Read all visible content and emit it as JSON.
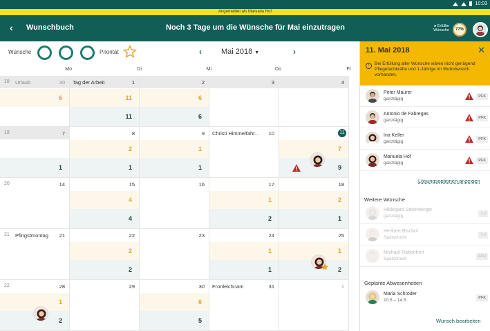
{
  "status": {
    "time": "10:03"
  },
  "login_banner": "Angemeldet als Manuela Hof",
  "appbar": {
    "title": "Wunschbuch",
    "headline": "Noch 3 Tage um die Wünsche für Mai einzutragen",
    "fulfilled_label": "ø Erfüllte Wünsche",
    "fulfilled_pct": "77%"
  },
  "toolbar": {
    "wishes_label": "Wünsche",
    "priority_label": "Priorität",
    "month": "Mai 2018",
    "prev_symbol": "‹",
    "next_symbol": "›"
  },
  "weekdays": [
    "Mo",
    "Di",
    "Mi",
    "Do",
    "Fr"
  ],
  "rows": [
    {
      "week": "18",
      "cells": [
        {
          "label": "Urlaub",
          "day": "30",
          "muted_day": true,
          "grey": true,
          "prio": "6",
          "wish": "",
          "label_muted": true
        },
        {
          "label": "Tag der Arbeit",
          "day": "1",
          "grey": true,
          "prio": "11",
          "wish": "11"
        },
        {
          "label": "",
          "day": "2",
          "grey": true,
          "prio": "6",
          "wish": "6"
        },
        {
          "label": "",
          "day": "3",
          "grey": true,
          "prio": "",
          "wish": ""
        },
        {
          "label": "",
          "day": "4",
          "grey": true,
          "prio": "",
          "wish": ""
        }
      ]
    },
    {
      "week": "19",
      "cells": [
        {
          "label": "",
          "day": "7",
          "grey": true,
          "prio": "",
          "wish": "1"
        },
        {
          "label": "",
          "day": "8",
          "prio": "2",
          "wish": "1"
        },
        {
          "label": "",
          "day": "9",
          "prio": "1",
          "wish": "1"
        },
        {
          "label": "Christi Himmelfahr...",
          "day": "10",
          "prio": "",
          "wish": ""
        },
        {
          "label": "",
          "day": "11",
          "today": true,
          "prio": "7",
          "wish": "9"
        }
      ]
    },
    {
      "week": "20",
      "cells": [
        {
          "label": "",
          "day": "14",
          "prio": "",
          "wish": ""
        },
        {
          "label": "",
          "day": "15",
          "prio": "4",
          "wish": "4"
        },
        {
          "label": "",
          "day": "16",
          "prio": "",
          "wish": ""
        },
        {
          "label": "",
          "day": "17",
          "prio": "1",
          "wish": "2"
        },
        {
          "label": "",
          "day": "18",
          "prio": "2",
          "wish": "1"
        }
      ]
    },
    {
      "week": "21",
      "cells": [
        {
          "label": "Pfingstmontag",
          "day": "21",
          "prio": "",
          "wish": ""
        },
        {
          "label": "",
          "day": "22",
          "prio": "2",
          "wish": "2"
        },
        {
          "label": "",
          "day": "23",
          "prio": "",
          "wish": ""
        },
        {
          "label": "",
          "day": "24",
          "prio": "1",
          "wish": "1"
        },
        {
          "label": "",
          "day": "25",
          "prio": "1",
          "wish": "2"
        }
      ]
    },
    {
      "week": "22",
      "cells": [
        {
          "label": "",
          "day": "28",
          "prio": "1",
          "wish": "2"
        },
        {
          "label": "",
          "day": "29",
          "prio": "",
          "wish": ""
        },
        {
          "label": "",
          "day": "30",
          "prio": "6",
          "wish": "5"
        },
        {
          "label": "Fronleichnam",
          "day": "31",
          "prio": "",
          "wish": ""
        },
        {
          "label": "",
          "day": "1",
          "muted_day": true,
          "prio": "",
          "wish": ""
        }
      ]
    }
  ],
  "panel": {
    "date": "11. Mai 2018",
    "info": "Bei Erfüllung aller Wünsche wären nicht genügend Pflegefachkräfte und 1-Jährige im Wohnbereich vorhanden.",
    "people": [
      {
        "name": "Peter Maurer",
        "shift": "ganztägig",
        "badge": "PFK"
      },
      {
        "name": "Antonio de Fabregas",
        "shift": "ganztägig",
        "badge": "PFK"
      },
      {
        "name": "Ina Keller",
        "shift": "ganztägig",
        "badge": "PFK"
      },
      {
        "name": "Manuela Hof",
        "shift": "ganztägig",
        "badge": "PFK"
      }
    ],
    "solutions_link": "Lösungsoptionen anzeigen",
    "more_title": "Weitere Wünsche",
    "more": [
      {
        "name": "Hildegard Steierberger",
        "shift": "ganztägig",
        "badge": "1-J"
      },
      {
        "name": "Heribert Bischof",
        "shift": "Spätschicht",
        "badge": "1-J"
      },
      {
        "name": "Michael Rabenhort",
        "shift": "Spätschicht",
        "badge": "APH"
      }
    ],
    "absence_title": "Geplante Abwesenheiten",
    "absence": {
      "name": "Maria Schröder",
      "shift": "10.5 – 14.5.",
      "badge": "PFK"
    },
    "edit_link": "Wunsch bearbeiten"
  },
  "colors": {
    "primary": "#115e57",
    "accent": "#f5b800",
    "priority": "#e3a52a"
  }
}
